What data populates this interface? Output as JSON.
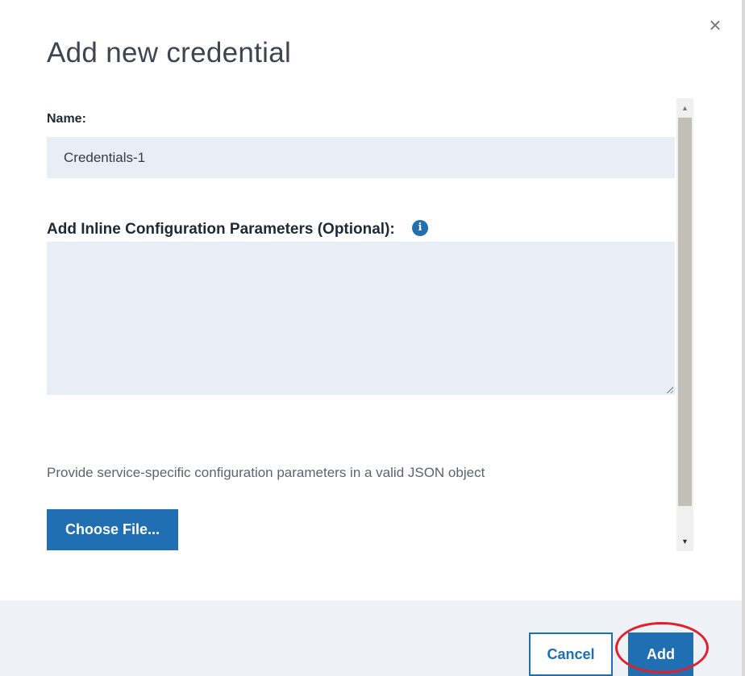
{
  "dialog": {
    "title": "Add new credential",
    "close_icon": "close-icon"
  },
  "form": {
    "name_label": "Name:",
    "name_value": "Credentials-1",
    "params_label": "Add Inline Configuration Parameters (Optional):",
    "params_value": "",
    "info_icon": "info-icon",
    "info_glyph": "i",
    "helper_text": "Provide service-specific configuration parameters in a valid JSON object",
    "choose_file_label": "Choose File..."
  },
  "footer": {
    "cancel_label": "Cancel",
    "add_label": "Add"
  },
  "colors": {
    "primary": "#1f6fb2",
    "field_bg": "#e8eef5",
    "footer_bg": "#eef1f5",
    "highlight": "#e0202a"
  }
}
